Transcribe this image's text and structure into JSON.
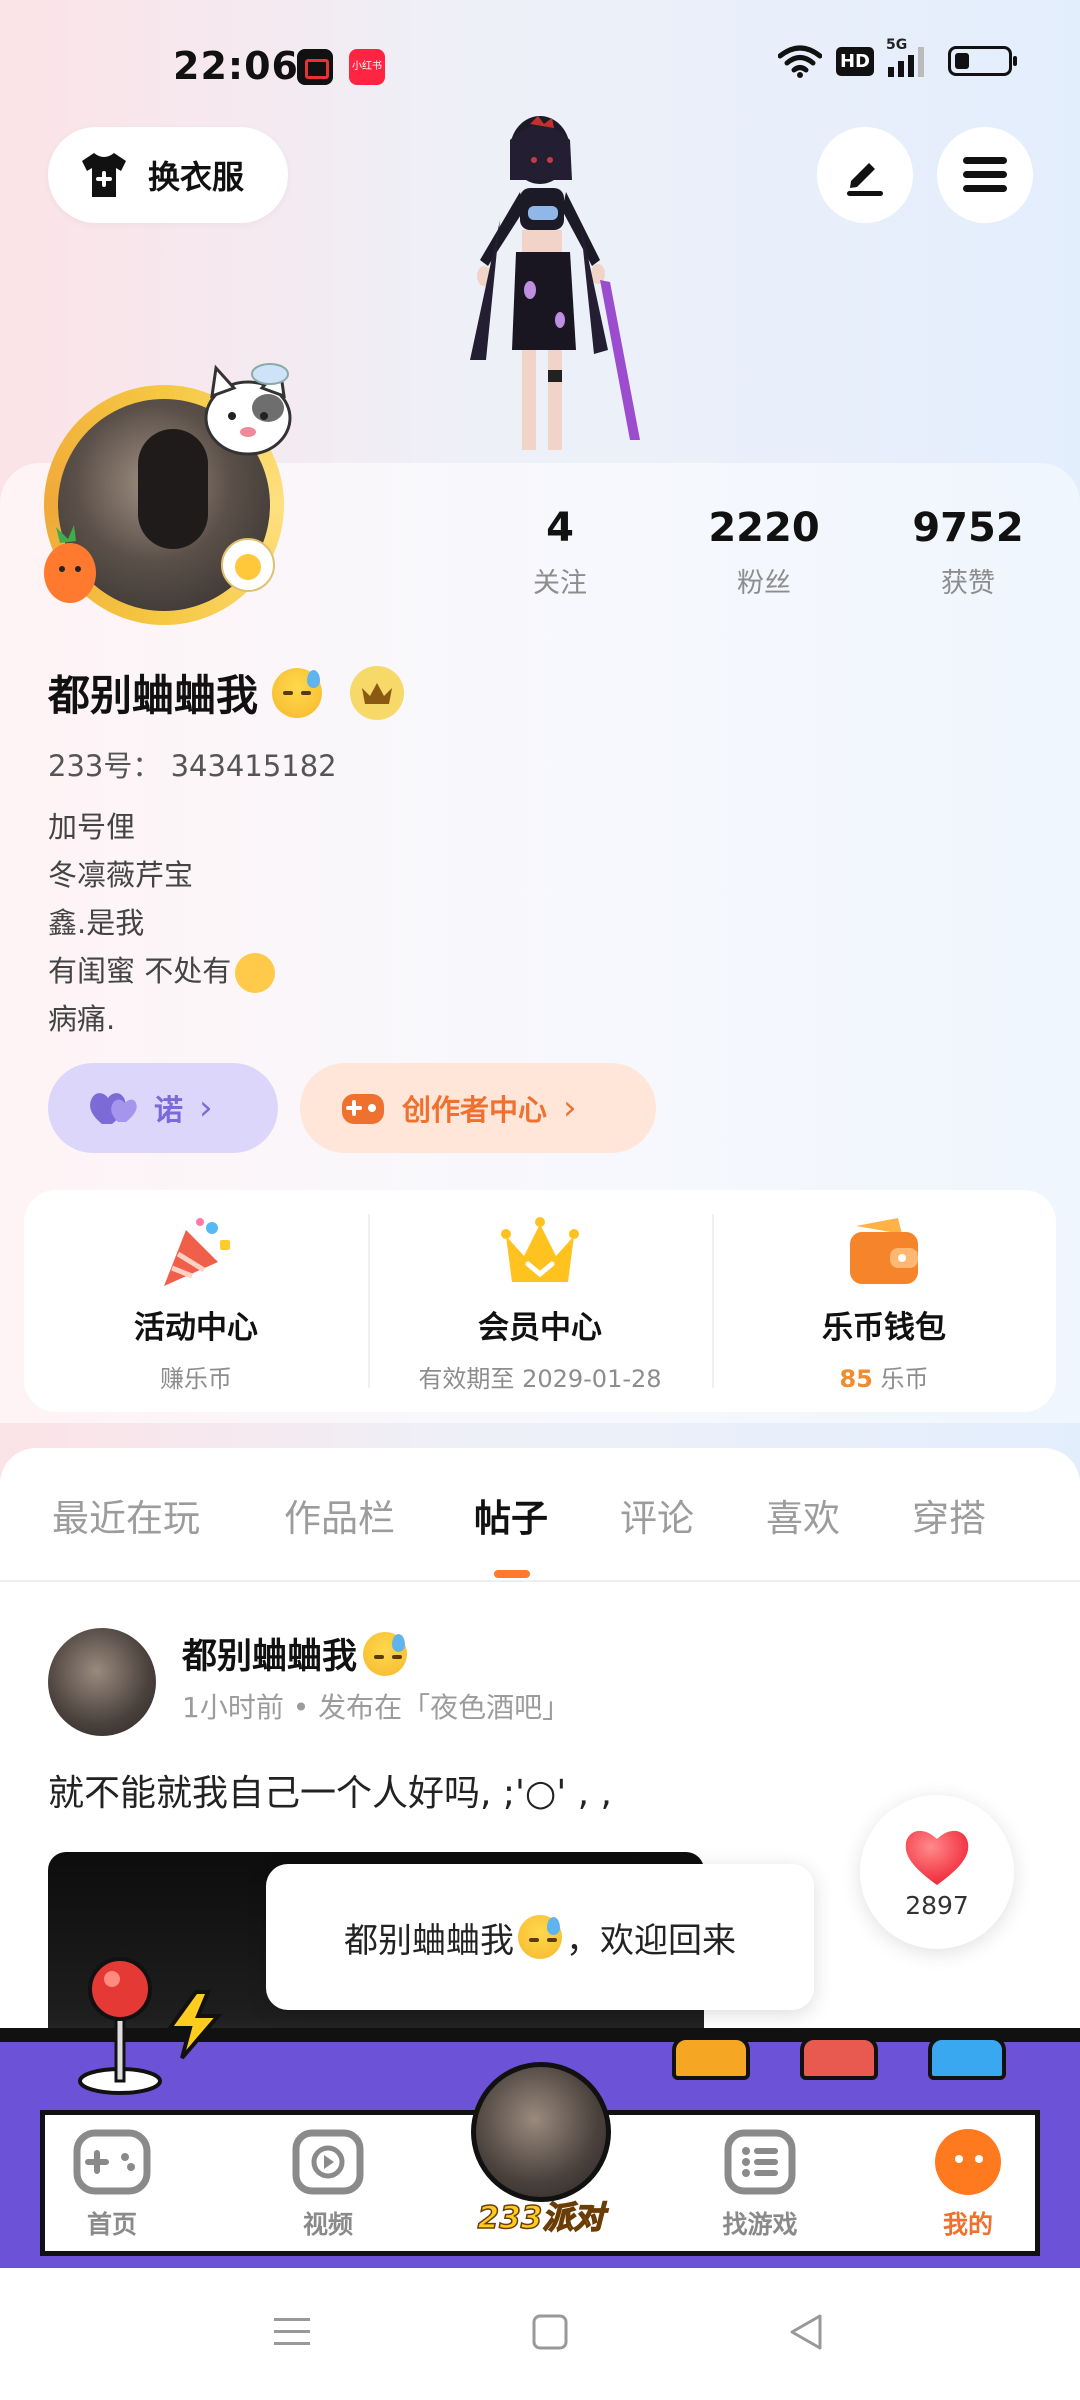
{
  "status_bar": {
    "time": "22:06",
    "network_badge": "HD",
    "signal_label": "5G",
    "app_badge_red": "小红书"
  },
  "header": {
    "outfit_label": "换衣服",
    "icons": [
      "tshirt-plus-icon",
      "edit-icon",
      "menu-icon"
    ]
  },
  "profile": {
    "stats": [
      {
        "value": "4",
        "label": "关注"
      },
      {
        "value": "2220",
        "label": "粉丝"
      },
      {
        "value": "9752",
        "label": "获赞"
      }
    ],
    "username": "都别蛐蛐我",
    "user_id": "233号： 343415182",
    "bio": [
      "加号俚",
      "冬凛薇芹宝",
      "鑫.是我",
      "有闺蜜 不处有",
      "病痛."
    ],
    "pills": {
      "heart_label": "诺",
      "creator_label": "创作者中心"
    }
  },
  "features": [
    {
      "title": "活动中心",
      "sub": "赚乐币",
      "icon": "party-popper-icon"
    },
    {
      "title": "会员中心",
      "sub": "有效期至 2029-01-28",
      "icon": "crown-icon"
    },
    {
      "title": "乐币钱包",
      "sub_number": "85",
      "sub_unit": "乐币",
      "icon": "wallet-icon"
    }
  ],
  "tabs": [
    "最近在玩",
    "作品栏",
    "帖子",
    "评论",
    "喜欢",
    "穿搭"
  ],
  "active_tab": "帖子",
  "post": {
    "author": "都别蛐蛐我",
    "meta": "1小时前 • 发布在「夜色酒吧」",
    "text": "就不能就我自己一个人好吗, ;'○' , ,"
  },
  "like_count": "2897",
  "toast": {
    "name": "都别蛐蛐我",
    "suffix": "，欢迎回来"
  },
  "bottom_nav": {
    "items": [
      {
        "label": "首页",
        "icon": "gamepad-icon"
      },
      {
        "label": "视频",
        "icon": "play-icon"
      },
      {
        "label": "找游戏",
        "icon": "list-icon"
      },
      {
        "label": "我的",
        "icon": "face-icon"
      }
    ],
    "center_label": "233派对",
    "active": "我的"
  },
  "colors": {
    "accent_orange": "#ef7130",
    "accent_purple": "#7c6ad6",
    "nav_purple": "#6b52d6",
    "party_yellow": "#ffcc1f"
  }
}
